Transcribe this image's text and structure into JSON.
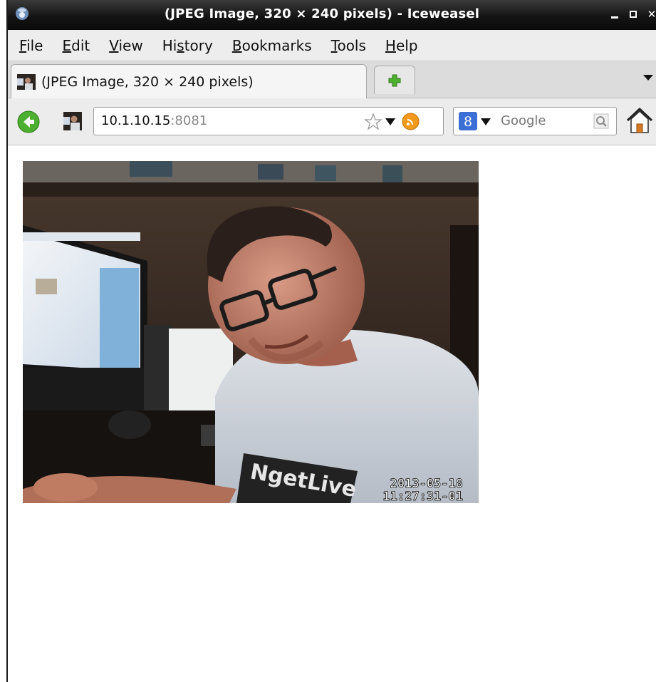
{
  "window": {
    "title": "(JPEG Image, 320 × 240 pixels) - Iceweasel",
    "controls": [
      "minimize",
      "maximize",
      "close"
    ]
  },
  "menu": {
    "items": [
      {
        "label": "File",
        "mnemonic": "F"
      },
      {
        "label": "Edit",
        "mnemonic": "E"
      },
      {
        "label": "View",
        "mnemonic": "V"
      },
      {
        "label": "History",
        "mnemonic": "s"
      },
      {
        "label": "Bookmarks",
        "mnemonic": "B"
      },
      {
        "label": "Tools",
        "mnemonic": "T"
      },
      {
        "label": "Help",
        "mnemonic": "H"
      }
    ]
  },
  "tabs": {
    "active_label": "(JPEG Image, 320 × 240 pixels)"
  },
  "nav": {
    "url_host": "10.1.10.15",
    "url_port": ":8081",
    "search_placeholder": "Google"
  },
  "content": {
    "image_timestamp_date": "2013-05-18",
    "image_timestamp_time": "11:27:31-01",
    "shirt_text": "NgetLive"
  },
  "colors": {
    "titlebar": "#141414",
    "menubar": "#ededed",
    "back_green": "#4caf2f",
    "google_blue": "#3b6fd6"
  }
}
